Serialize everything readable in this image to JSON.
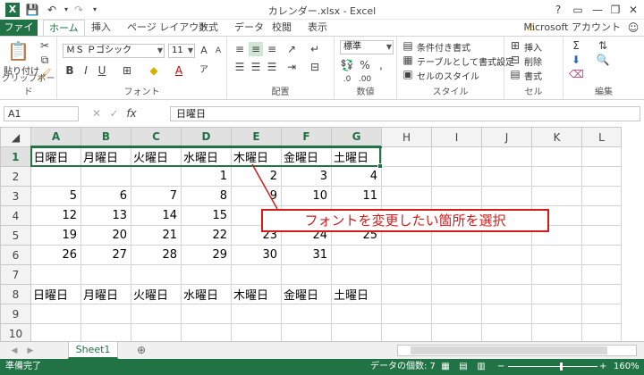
{
  "titlebar": {
    "title": "カレンダー.xlsx - Excel",
    "help": "?",
    "ribbon_options": "▭",
    "minimize": "—",
    "restore": "❐",
    "close": "✕"
  },
  "tabs": {
    "file": "ファイル",
    "items": [
      "ホーム",
      "挿入",
      "ページ レイアウト",
      "数式",
      "データ",
      "校閲",
      "表示"
    ],
    "account": "Microsoft アカウント"
  },
  "ribbon": {
    "clipboard": {
      "paste": "貼り付け",
      "label": "クリップボード"
    },
    "font": {
      "name": "ＭＳ Ｐゴシック",
      "size": "11",
      "bold": "B",
      "italic": "I",
      "underline": "U",
      "grow": "A",
      "shrink": "A",
      "label": "フォント"
    },
    "alignment": {
      "label": "配置"
    },
    "number": {
      "format": "標準",
      "label": "数値"
    },
    "styles": {
      "conditional": "条件付き書式",
      "table": "テーブルとして書式設定",
      "cell": "セルのスタイル",
      "label": "スタイル"
    },
    "cells": {
      "insert": "挿入",
      "delete": "削除",
      "format": "書式",
      "label": "セル"
    },
    "editing": {
      "label": "編集"
    }
  },
  "formula_bar": {
    "namebox": "A1",
    "fx": "fx",
    "value": "日曜日"
  },
  "grid": {
    "columns": [
      "A",
      "B",
      "C",
      "D",
      "E",
      "F",
      "G",
      "H",
      "I",
      "J",
      "K",
      "L"
    ],
    "rows": [
      {
        "num": "1",
        "cells": [
          "日曜日",
          "月曜日",
          "火曜日",
          "水曜日",
          "木曜日",
          "金曜日",
          "土曜日",
          "",
          "",
          "",
          "",
          ""
        ]
      },
      {
        "num": "2",
        "cells": [
          "",
          "",
          "",
          "1",
          "2",
          "3",
          "4",
          "",
          "",
          "",
          "",
          ""
        ]
      },
      {
        "num": "3",
        "cells": [
          "5",
          "6",
          "7",
          "8",
          "9",
          "10",
          "11",
          "",
          "",
          "",
          "",
          ""
        ]
      },
      {
        "num": "4",
        "cells": [
          "12",
          "13",
          "14",
          "15",
          "16",
          "17",
          "18",
          "",
          "",
          "",
          "",
          ""
        ]
      },
      {
        "num": "5",
        "cells": [
          "19",
          "20",
          "21",
          "22",
          "23",
          "24",
          "25",
          "",
          "",
          "",
          "",
          ""
        ]
      },
      {
        "num": "6",
        "cells": [
          "26",
          "27",
          "28",
          "29",
          "30",
          "31",
          "",
          "",
          "",
          "",
          "",
          ""
        ]
      },
      {
        "num": "7",
        "cells": [
          "",
          "",
          "",
          "",
          "",
          "",
          "",
          "",
          "",
          "",
          "",
          ""
        ]
      },
      {
        "num": "8",
        "cells": [
          "日曜日",
          "月曜日",
          "火曜日",
          "水曜日",
          "木曜日",
          "金曜日",
          "土曜日",
          "",
          "",
          "",
          "",
          ""
        ]
      },
      {
        "num": "9",
        "cells": [
          "",
          "",
          "",
          "",
          "",
          "",
          "",
          "",
          "",
          "",
          "",
          ""
        ]
      },
      {
        "num": "10",
        "cells": [
          "",
          "",
          "",
          "",
          "",
          "",
          "",
          "",
          "",
          "",
          "",
          ""
        ]
      }
    ],
    "selected_row": "1",
    "selected_columns": [
      "A",
      "B",
      "C",
      "D",
      "E",
      "F",
      "G"
    ]
  },
  "callout": {
    "text": "フォントを変更したい箇所を選択",
    "color": "#d71a1a"
  },
  "sheets": {
    "active": "Sheet1",
    "add": "⊕"
  },
  "status": {
    "ready": "準備完了",
    "count": "データの個数: 7",
    "zoom": "160%"
  },
  "colors": {
    "accent": "#217346"
  }
}
